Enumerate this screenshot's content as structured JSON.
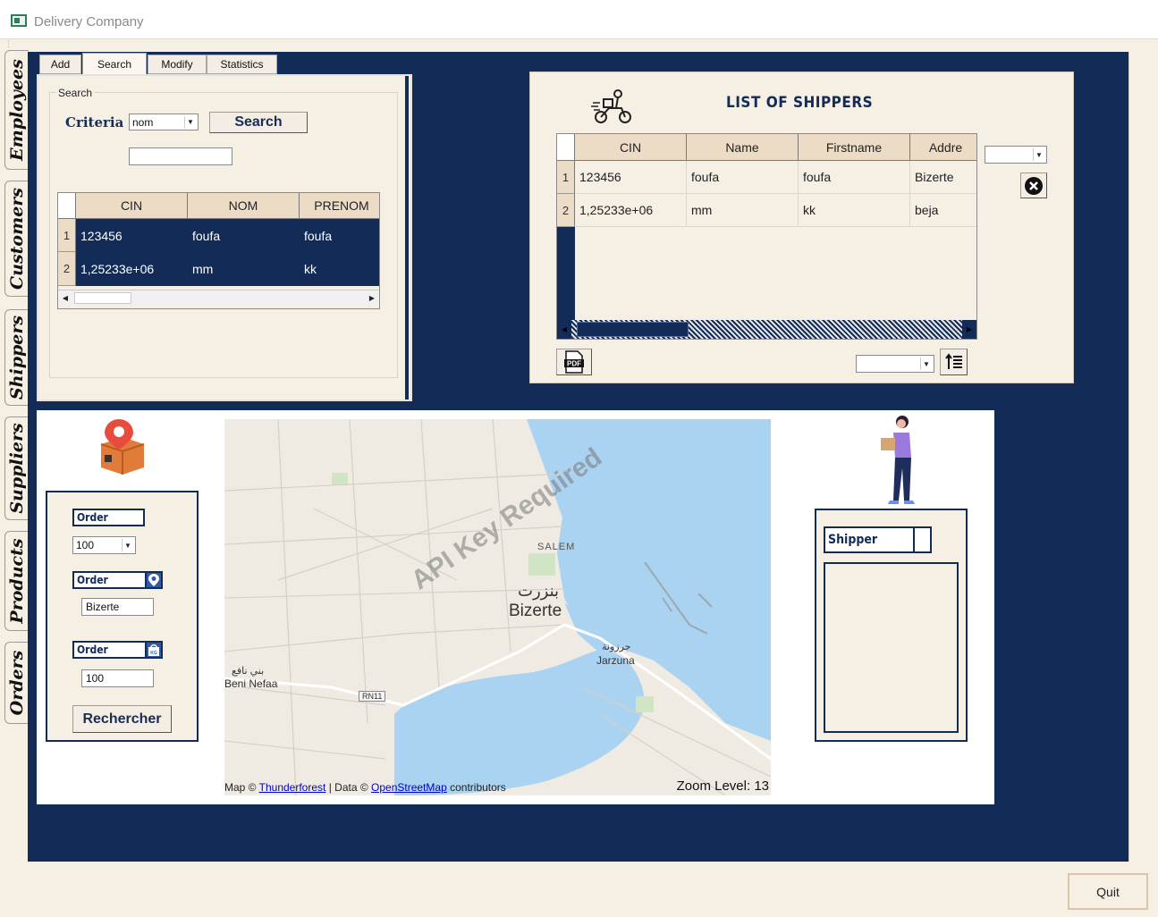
{
  "window": {
    "title": "Delivery Company"
  },
  "vertical_tabs": [
    "Orders",
    "Products",
    "Suppliers",
    "Shippers",
    "Customers",
    "Employees"
  ],
  "tabs": [
    "Add",
    "Search",
    "Modify",
    "Statistics"
  ],
  "search_panel": {
    "group_label": "Search",
    "criteria_label": "Criteria",
    "criteria_value": "nom",
    "search_button": "Search",
    "search_text": "",
    "columns": [
      "CIN",
      "NOM",
      "PRENOM"
    ],
    "rows": [
      {
        "num": "1",
        "cells": [
          "123456",
          "foufa",
          "foufa"
        ]
      },
      {
        "num": "2",
        "cells": [
          "1,25233e+06",
          "mm",
          "kk"
        ]
      }
    ]
  },
  "shippers_panel": {
    "title": "LIST OF SHIPPERS",
    "columns": [
      "CIN",
      "Name",
      "Firstname",
      "Addre"
    ],
    "rows": [
      {
        "num": "1",
        "cells": [
          "123456",
          "foufa",
          "foufa",
          "Bizerte"
        ]
      },
      {
        "num": "2",
        "cells": [
          "1,25233e+06",
          "mm",
          "kk",
          "beja"
        ]
      }
    ],
    "pdf_label": "PDF"
  },
  "order_panel": {
    "label1": "Order",
    "value1": "100",
    "label2": "Order",
    "value2": "Bizerte",
    "label3": "Order",
    "value3": "100",
    "kg_label": "KG",
    "button": "Rechercher"
  },
  "map": {
    "watermark": "API Key Required",
    "place_ar": "بنزرت",
    "place": "Bizerte",
    "place2_ar": "جرزونة",
    "place2": "Jarzuna",
    "place3_ar": "بني نافع",
    "place3": "Beni Nefaa",
    "place4": "SALEM",
    "road": "RN11",
    "credit_prefix": "Map ©",
    "credit_link1": "Thunderforest",
    "credit_mid": "| Data ©",
    "credit_link2": "OpenStreetMap",
    "credit_suffix": "contributors",
    "zoom_label": "Zoom Level: 13"
  },
  "shipper_panel": {
    "label": "Shipper"
  },
  "quit_button": "Quit",
  "colors": {
    "navy": "#122b57",
    "beige": "#f6efe4",
    "header": "#ecdcc6",
    "sea": "#aad3f2"
  }
}
